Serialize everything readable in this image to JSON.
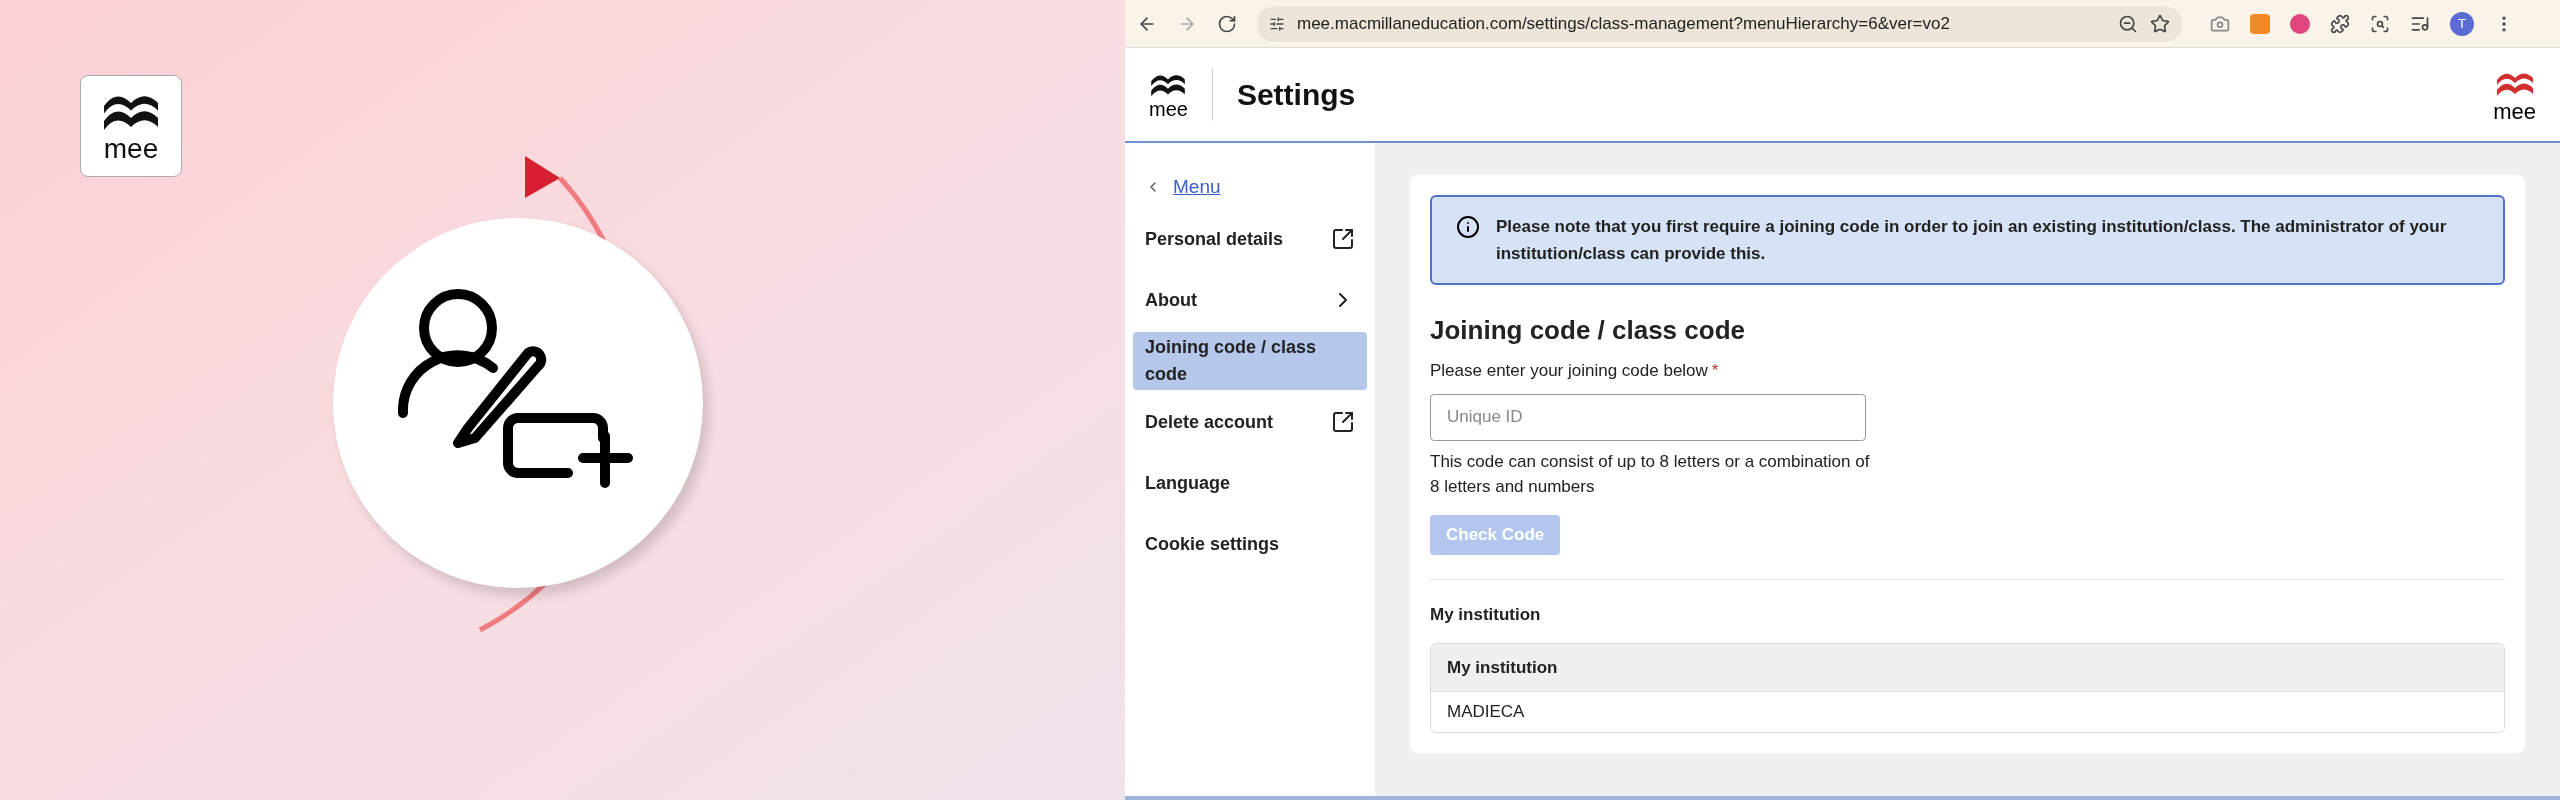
{
  "promo": {
    "logo_text": "mee"
  },
  "browser": {
    "url": "mee.macmillaneducation.com/settings/class-management?menuHierarchy=6&ver=vo2",
    "profile": "T"
  },
  "header": {
    "logo_text": "mee",
    "title": "Settings",
    "brand_text": "mee"
  },
  "sidebar": {
    "back": "Menu",
    "items": [
      {
        "label": "Personal details",
        "kind": "external",
        "selected": false
      },
      {
        "label": "About",
        "kind": "submenu",
        "selected": false
      },
      {
        "label": "Joining code / class code",
        "kind": "plain",
        "selected": true
      },
      {
        "label": "Delete account",
        "kind": "external",
        "selected": false
      },
      {
        "label": "Language",
        "kind": "plain",
        "selected": false
      },
      {
        "label": "Cookie settings",
        "kind": "plain",
        "selected": false
      }
    ]
  },
  "notice": "Please note that you first require a joining code in order to join an existing institution/class. The administrator of your institution/class can provide this.",
  "form": {
    "heading": "Joining code / class code",
    "label": "Please enter your joining code below",
    "required_mark": "*",
    "placeholder": "Unique ID",
    "hint": "This code can consist of up to 8 letters or a combination of 8 letters and numbers",
    "button": {
      "label": "Check Code",
      "disabled": true
    }
  },
  "institution": {
    "title": "My institution",
    "table": {
      "columns": [
        "My institution"
      ],
      "rows": [
        [
          "MADIECA"
        ]
      ]
    }
  }
}
